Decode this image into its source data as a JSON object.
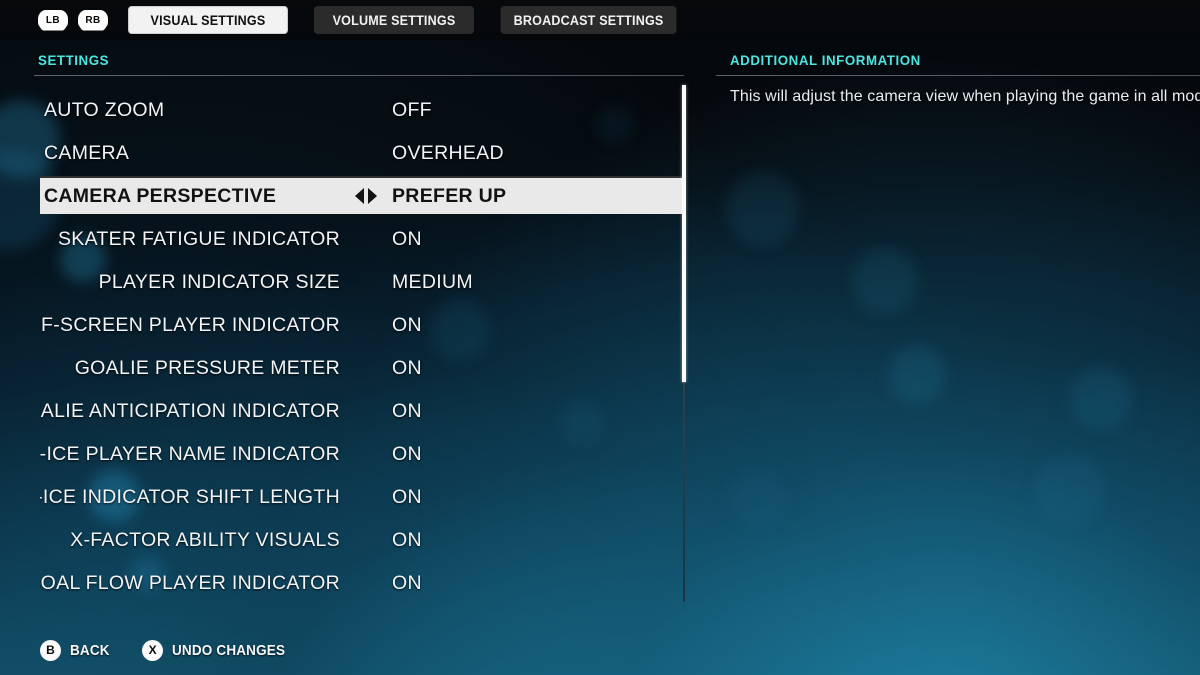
{
  "topbar": {
    "bumpers": [
      {
        "name": "lb-bumper",
        "label": "LB"
      },
      {
        "name": "rb-bumper",
        "label": "RB"
      }
    ],
    "tabs": [
      {
        "label": "VISUAL SETTINGS",
        "active": true
      },
      {
        "label": "VOLUME SETTINGS",
        "active": false
      },
      {
        "label": "BROADCAST SETTINGS",
        "active": false
      }
    ]
  },
  "settings_panel": {
    "header": "SETTINGS",
    "rows": [
      {
        "label": "AUTO ZOOM",
        "value": "OFF",
        "selected": false,
        "clipped": false
      },
      {
        "label": "CAMERA",
        "value": "OVERHEAD",
        "selected": false,
        "clipped": false
      },
      {
        "label": "CAMERA PERSPECTIVE",
        "value": "PREFER UP",
        "selected": true,
        "clipped": false
      },
      {
        "label": "SKATER FATIGUE INDICATOR",
        "value": "ON",
        "selected": false,
        "clipped": true
      },
      {
        "label": "PLAYER INDICATOR SIZE",
        "value": "MEDIUM",
        "selected": false,
        "clipped": true
      },
      {
        "label": "OFF-SCREEN PLAYER INDICATOR",
        "value": "ON",
        "selected": false,
        "clipped": true
      },
      {
        "label": "GOALIE PRESSURE METER",
        "value": "ON",
        "selected": false,
        "clipped": true
      },
      {
        "label": "GOALIE ANTICIPATION INDICATOR",
        "value": "ON",
        "selected": false,
        "clipped": true
      },
      {
        "label": "ON-ICE PLAYER NAME INDICATOR",
        "value": "ON",
        "selected": false,
        "clipped": true
      },
      {
        "label": "ON-ICE INDICATOR SHIFT LENGTH",
        "value": "ON",
        "selected": false,
        "clipped": true
      },
      {
        "label": "X-FACTOR ABILITY VISUALS",
        "value": "ON",
        "selected": false,
        "clipped": true
      },
      {
        "label": "ON-ICE POST-GOAL FLOW PLAYER INDICATOR",
        "value": "ON",
        "selected": false,
        "clipped": true
      }
    ],
    "arrows": {
      "left": "◀",
      "right": "▶"
    }
  },
  "info_panel": {
    "header": "ADDITIONAL INFORMATION",
    "text": "This will adjust the camera view when playing the game in all modes."
  },
  "bottombar": {
    "hints": [
      {
        "glyph": "B",
        "label": "BACK"
      },
      {
        "glyph": "X",
        "label": "UNDO CHANGES"
      }
    ]
  },
  "colors": {
    "accent_cyan": "#4ce6e0",
    "selected_row_bg": "#e9e9e9",
    "tab_active_bg": "#f2f2f2",
    "tab_inactive_bg": "#2b2b2b",
    "text_primary": "#f2f4f6",
    "background_deep": "#05090d",
    "background_teal": "#15596f"
  }
}
